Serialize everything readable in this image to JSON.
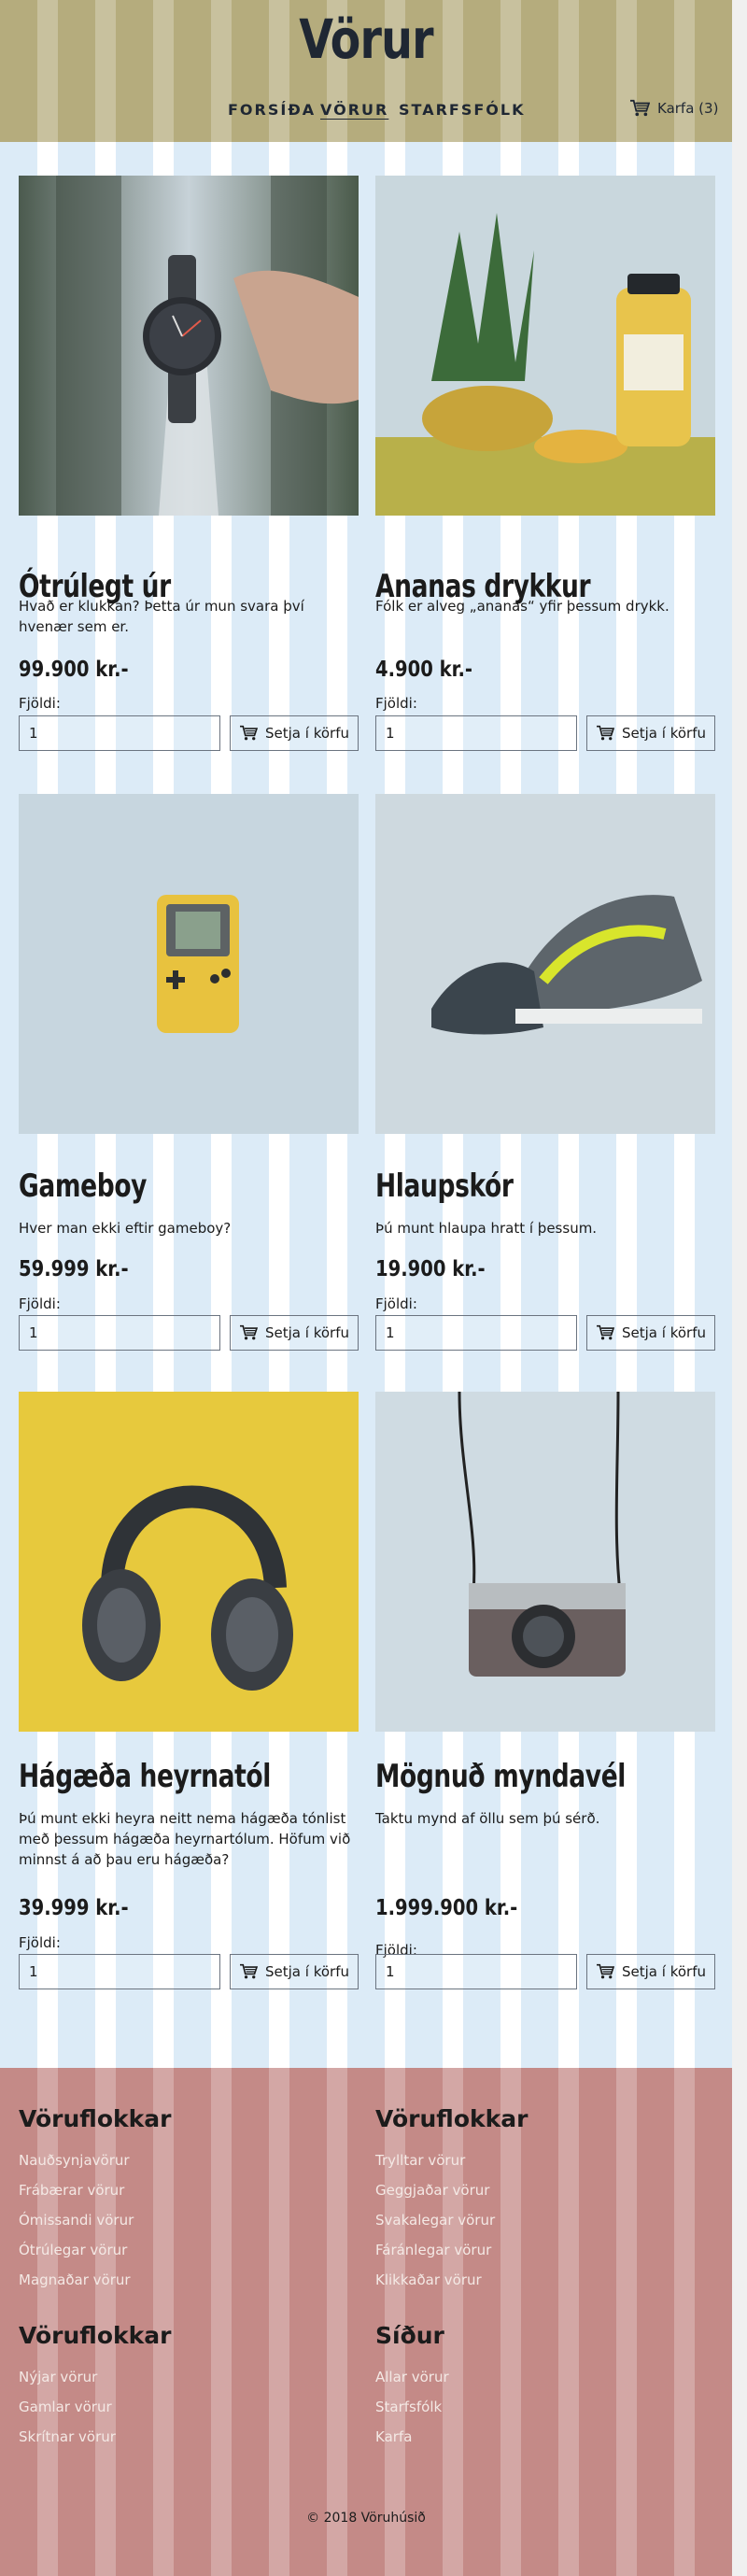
{
  "site": {
    "title": "Vörur",
    "nav": [
      {
        "label": "Forsíða",
        "active": false
      },
      {
        "label": "Vörur",
        "active": true
      },
      {
        "label": "Starfsfólk",
        "active": false
      }
    ],
    "cart_label": "Karfa (3)"
  },
  "colors": {
    "header_bg": "#b5ac7d",
    "stripe_blue": "#dcebf7",
    "footer_bg": "#c48a87",
    "text_dark": "#1b1b1b"
  },
  "products": [
    {
      "name": "Ótrúlegt úr",
      "description": "Hvað er klukkan? Þetta úr mun svara því hvenær sem er.",
      "price": "99.900 kr.-",
      "qty_label": "Fjöldi:",
      "qty_value": "1",
      "button_label": "Setja í körfu",
      "image": "watch-photo"
    },
    {
      "name": "Ananas drykkur",
      "description": "Fólk er alveg „ananas“ yfir þessum drykk.",
      "price": "4.900 kr.-",
      "qty_label": "Fjöldi:",
      "qty_value": "1",
      "button_label": "Setja í körfu",
      "image": "pineapple-drink-photo"
    },
    {
      "name": "Gameboy",
      "description": "Hver man ekki eftir gameboy?",
      "price": "59.999 kr.-",
      "qty_label": "Fjöldi:",
      "qty_value": "1",
      "button_label": "Setja í körfu",
      "image": "gameboy-photo"
    },
    {
      "name": "Hlaupskór",
      "description": "Þú munt hlaupa hratt í þessum.",
      "price": "19.900 kr.-",
      "qty_label": "Fjöldi:",
      "qty_value": "1",
      "button_label": "Setja í körfu",
      "image": "sneakers-photo"
    },
    {
      "name": "Hágæða heyrnatól",
      "description": "Þú munt ekki heyra neitt nema hágæða tónlist með þessum hágæða heyrnartólum. Höfum við minnst á að þau eru hágæða?",
      "price": "39.999 kr.-",
      "qty_label": "Fjöldi:",
      "qty_value": "1",
      "button_label": "Setja í körfu",
      "image": "headphones-photo"
    },
    {
      "name": "Mögnuð myndavél",
      "description": "Taktu mynd af öllu sem þú sérð.",
      "price": "1.999.900 kr.-",
      "qty_label": "Fjöldi:",
      "qty_value": "1",
      "button_label": "Setja í körfu",
      "image": "camera-photo"
    }
  ],
  "footer": {
    "columns": [
      {
        "heading": "Vöruflokkar",
        "links": [
          "Nauðsynjavörur",
          "Frábærar vörur",
          "Ómissandi vörur",
          "Ótrúlegar vörur",
          "Magnaðar vörur"
        ]
      },
      {
        "heading": "Vöruflokkar",
        "links": [
          "Trylltar vörur",
          "Geggjaðar vörur",
          "Svakalegar vörur",
          "Fáránlegar vörur",
          "Klikkaðar vörur"
        ]
      },
      {
        "heading": "Vöruflokkar",
        "links": [
          "Nýjar vörur",
          "Gamlar vörur",
          "Skrítnar vörur"
        ]
      },
      {
        "heading": "Síður",
        "links": [
          "Allar vörur",
          "Starfsfólk",
          "Karfa"
        ]
      }
    ],
    "copyright": "© 2018 Vöruhúsið"
  }
}
